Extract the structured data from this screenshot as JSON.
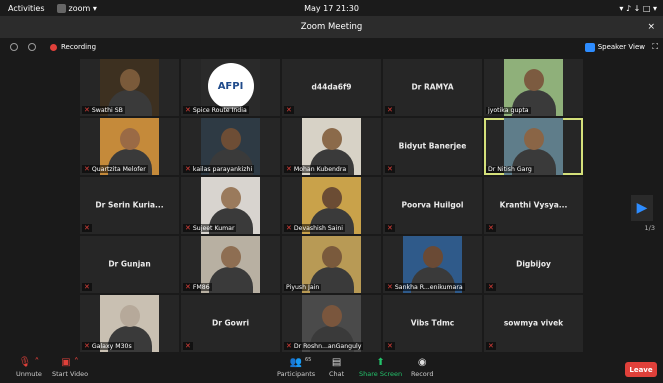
{
  "system_bar": {
    "activities": "Activities",
    "app_name": "zoom ▾",
    "clock": "May 17  21:30",
    "sys_icons": "▾ ♪ ↓ □ ▾"
  },
  "window": {
    "title": "Zoom Meeting",
    "close": "×"
  },
  "infobar": {
    "recording": "Recording",
    "speaker_view": "Speaker View",
    "fullscreen": "⛶"
  },
  "participants": [
    {
      "name": "Swathi SB",
      "video": true,
      "skin": "#7a5a3a",
      "bg": "#3d3020",
      "muted": true,
      "center": false
    },
    {
      "name": "Spice Route India",
      "video": true,
      "skin": "#ffffff",
      "bg": "#2a2a2a",
      "muted": true,
      "logo": "AFPI"
    },
    {
      "name": "d44da6f9",
      "video": false,
      "muted": true
    },
    {
      "name": "Dr RAMYA",
      "video": false,
      "muted": true
    },
    {
      "name": "jyotika gupta",
      "video": true,
      "skin": "#7c5b40",
      "bg": "#8fb07a",
      "muted": false
    },
    {
      "name": "Quartzita Melofer",
      "video": true,
      "skin": "#9a6a45",
      "bg": "#c58a3a",
      "muted": true
    },
    {
      "name": "kailas parayankizhi",
      "video": true,
      "skin": "#6d4d35",
      "bg": "#2e3a44",
      "muted": true
    },
    {
      "name": "Mohan Kubendra",
      "video": true,
      "skin": "#8b6a4a",
      "bg": "#d7d2c6",
      "muted": true
    },
    {
      "name": "Bidyut Banerjee",
      "video": false,
      "muted": true
    },
    {
      "name": "Dr Nitish Garg",
      "video": true,
      "skin": "#8a6546",
      "bg": "#5f7d8a",
      "muted": false,
      "active": true
    },
    {
      "name": "Dr Serin Kuria...",
      "video": false,
      "muted": true
    },
    {
      "name": "Sujeet Kumar",
      "video": true,
      "skin": "#9a7a5c",
      "bg": "#d8d4cf",
      "muted": true
    },
    {
      "name": "Devashish Saini",
      "video": true,
      "skin": "#6b4c34",
      "bg": "#c9a24a",
      "muted": true
    },
    {
      "name": "Poorva Huilgol",
      "video": false,
      "muted": true
    },
    {
      "name": "Kranthi Vysya...",
      "video": false,
      "muted": true
    },
    {
      "name": "Dr Gunjan",
      "video": false,
      "muted": true
    },
    {
      "name": "FM86",
      "video": true,
      "skin": "#8e6e52",
      "bg": "#b8b0a2",
      "muted": true
    },
    {
      "name": "Piyush Jain",
      "video": true,
      "skin": "#7a5a3c",
      "bg": "#b89a55",
      "muted": false
    },
    {
      "name": "Sankha R...enikumara",
      "video": true,
      "skin": "#6a4a35",
      "bg": "#2f5a8a",
      "muted": true
    },
    {
      "name": "Digbijoy",
      "video": false,
      "muted": true
    },
    {
      "name": "Galaxy M30s",
      "video": true,
      "skin": "#b6a99a",
      "bg": "#c9c0b2",
      "muted": true
    },
    {
      "name": "Dr Gowri",
      "video": false,
      "muted": true
    },
    {
      "name": "Dr Roshn...anGanguly",
      "video": true,
      "skin": "#7a563d",
      "bg": "#4a4a4a",
      "muted": true
    },
    {
      "name": "Vibs Tdmc",
      "video": false,
      "muted": true
    },
    {
      "name": "sowmya vivek",
      "video": false,
      "muted": true
    }
  ],
  "pagination": {
    "next": "▶",
    "page": "1/3"
  },
  "toolbar": {
    "unmute": "Unmute",
    "start_video": "Start Video",
    "participants": "Participants",
    "participant_count": "65",
    "chat": "Chat",
    "share_screen": "Share Screen",
    "record": "Record",
    "leave": "Leave"
  },
  "colors": {
    "accent_blue": "#2d8cff",
    "leave_red": "#e0403a",
    "share_green": "#23c26b",
    "active_speaker": "#d4e07a"
  }
}
